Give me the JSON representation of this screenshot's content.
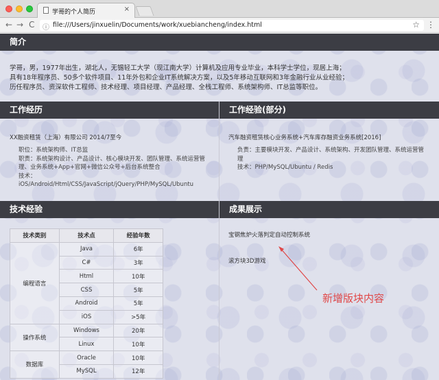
{
  "browser": {
    "tab_title": "学哥的个人简历",
    "tab_close": "×",
    "url": "file:///Users/jinxuelin/Documents/work/xuebiancheng/index.html",
    "back": "←",
    "forward": "→",
    "reload": "C",
    "star": "☆",
    "menu": "⋮",
    "file_icon": "ⓘ"
  },
  "sections": {
    "intro": "简介",
    "work": "工作经历",
    "projects": "工作经验(部分)",
    "skills": "技术经验",
    "achievements": "成果展示"
  },
  "intro": {
    "lines": [
      "学哥，男，1977年出生，湖北人，无锡轻工大学（现江南大学）计算机及应用专业毕业，本科学士学位，现居上海；",
      "具有18年程序员、50多个软件项目、11年外包和企业IT系统解决方案，以及5年移动互联网和3年金融行业从业经验；",
      "历任程序员、资深软件工程师、技术经理、项目经理、产品经理、全栈工程师、系统架构师、IT总监等职位。"
    ]
  },
  "work": {
    "company": "XX融资租赁（上海）有限公司 2014/7至今",
    "lines": [
      "职位：系统架构师、IT总监",
      "职责：系统架构设计、产品设计、核心模块开发、团队管理、系统运营管理、业务系统+App+官网+微信公众号+后台系统整合",
      "技术：",
      "iOS/Android/Html/CSS/JavaScript/jQuery/PHP/MySQL/Ubuntu"
    ]
  },
  "projects": {
    "title": "汽车融资租赁核心业务系统+汽车库存融资业务系统[2016]",
    "lines": [
      "负责：主要模块开发、产品设计、系统架构、开发团队管理、系统运营管理",
      "技术：PHP/MySQL/Ubuntu / Redis"
    ]
  },
  "skills_table": {
    "headers": [
      "技术类别",
      "技术点",
      "经验年数"
    ],
    "groups": [
      {
        "category": "编程语言",
        "rows": [
          [
            "Java",
            "6年"
          ],
          [
            "C#",
            "3年"
          ],
          [
            "Html",
            "10年"
          ],
          [
            "CSS",
            "5年"
          ],
          [
            "Android",
            "5年"
          ],
          [
            "iOS",
            ">5年"
          ]
        ]
      },
      {
        "category": "操作系统",
        "rows": [
          [
            "Windows",
            "20年"
          ],
          [
            "Linux",
            "10年"
          ]
        ]
      },
      {
        "category": "数据库",
        "rows": [
          [
            "Oracle",
            "10年"
          ],
          [
            "MySQL",
            "12年"
          ]
        ]
      }
    ]
  },
  "achievements": {
    "items": [
      "宝钢焦炉火落判定自动控制系统",
      "滚方块3D游戏"
    ]
  },
  "annotation": {
    "text": "新增版块内容",
    "color": "#e04848"
  }
}
